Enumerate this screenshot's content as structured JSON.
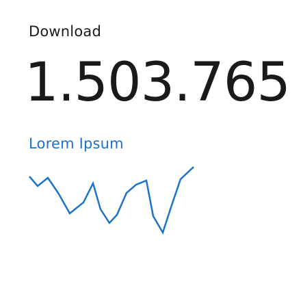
{
  "widget": {
    "title": "Download",
    "value": "1.503.765",
    "subtitle": "Lorem Ipsum"
  },
  "colors": {
    "text": "#1a1a1a",
    "accent": "#1a73c8",
    "background": "#ffffff"
  }
}
